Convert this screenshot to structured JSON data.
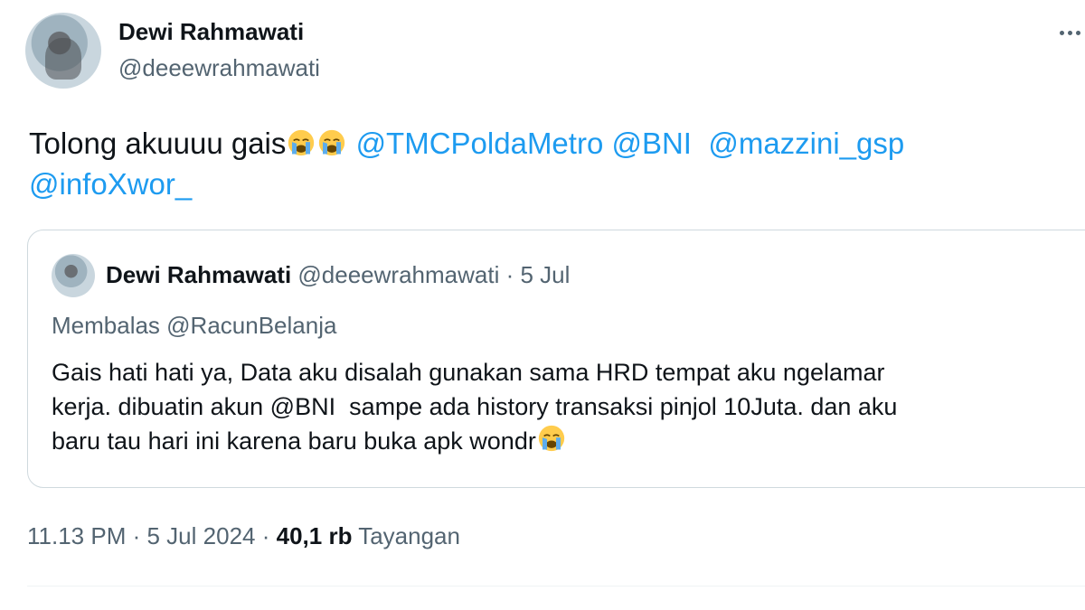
{
  "author": {
    "display_name": "Dewi Rahmawati",
    "handle": "@deeewrahmawati"
  },
  "tweet": {
    "text_before": "Tolong akuuuu gais",
    "emoji_icons": [
      "loudly-crying-face-icon",
      "loudly-crying-face-icon"
    ],
    "mentions": [
      "@TMCPoldaMetro",
      "@BNI",
      "@mazzini_gsp",
      "@infoXwor_"
    ]
  },
  "quoted_tweet": {
    "display_name": "Dewi Rahmawati",
    "handle": "@deeewrahmawati",
    "separator": "·",
    "date": "5 Jul",
    "replying_label": "Membalas @RacunBelanja",
    "body_lines": [
      "Gais hati hati ya, Data aku disalah gunakan sama HRD tempat aku ngelamar",
      "kerja. dibuatin akun ",
      "baru tau hari ini karena baru buka apk wondr"
    ],
    "body_mention": "@BNI",
    "body_line2_after": "  sampe ada history transaksi pinjol 10Juta. dan aku"
  },
  "meta": {
    "time": "11.13 PM",
    "separator": "·",
    "date": "5 Jul 2024",
    "separator2": "·",
    "views_count": "40,1 rb",
    "views_label": "Tayangan"
  },
  "colors": {
    "mention": "#1d9bf0",
    "secondary_text": "#536471",
    "primary_text": "#0f1419",
    "border": "#cfd9de"
  }
}
